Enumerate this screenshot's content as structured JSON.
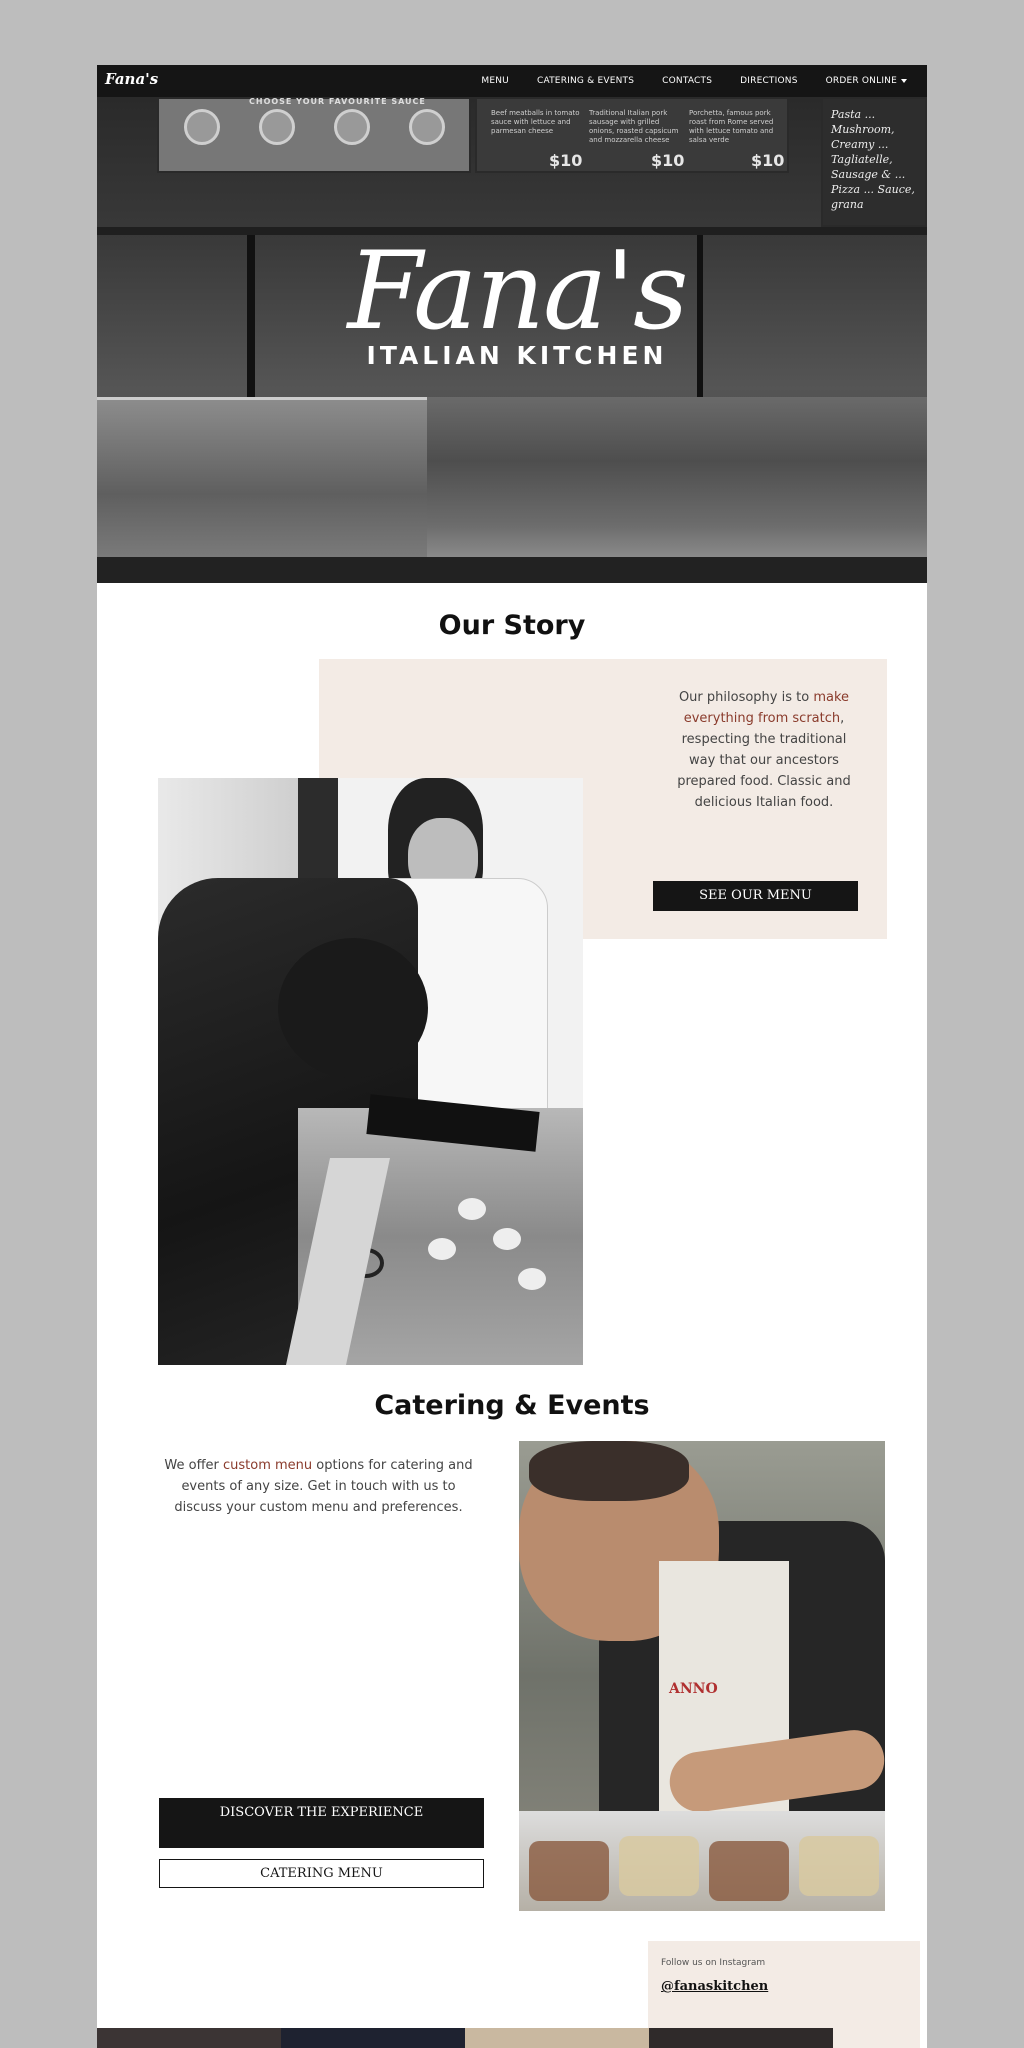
{
  "nav": {
    "logo": "Fana's",
    "items": [
      {
        "label": "MENU"
      },
      {
        "label": "CATERING & EVENTS"
      },
      {
        "label": "CONTACTS"
      },
      {
        "label": "DIRECTIONS"
      },
      {
        "label": "ORDER ONLINE"
      }
    ]
  },
  "hero": {
    "script_title": "Fana's",
    "subtitle": "ITALIAN KITCHEN",
    "board_heading": "CHOOSE YOUR FAVOURITE SAUCE",
    "prices": [
      "$10",
      "$10",
      "$10"
    ],
    "board_items": [
      "Beef meatballs in tomato sauce with lettuce and parmesan cheese",
      "Traditional Italian pork sausage with grilled onions, roasted capsicum and mozzarella cheese",
      "Porchetta, famous pork roast from Rome served with lettuce tomato and salsa verde"
    ],
    "chalkboard": "Pasta ... Mushroom, Creamy ... Tagliatelle, Sausage & ... Pizza ... Sauce, grana"
  },
  "story": {
    "title": "Our Story",
    "text_before": "Our philosophy is to ",
    "text_accent": "make everything from scratch",
    "text_after": ", respecting the traditional way that our ancestors prepared food. Classic and delicious Italian food.",
    "button": "SEE OUR MENU"
  },
  "catering": {
    "title": "Catering & Events",
    "text_before": "We offer ",
    "text_accent": "custom menu",
    "text_after": " options for catering and events of any size. Get in touch with us to discuss your custom menu and preferences.",
    "button_primary": "DISCOVER THE EXPERIENCE",
    "button_secondary": "CATERING MENU"
  },
  "instagram": {
    "label": "Follow us on Instagram",
    "handle": "@fanaskitchen"
  },
  "colors": {
    "accent": "#8a3b2c",
    "panel": "#f3ebe5",
    "dark": "#151515"
  }
}
